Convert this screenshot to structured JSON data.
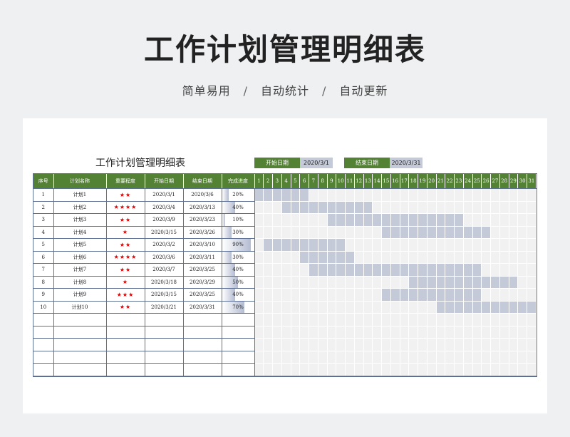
{
  "hero": {
    "title": "工作计划管理明细表",
    "tagline": [
      "简单易用",
      "自动统计",
      "自动更新"
    ],
    "separator": "/"
  },
  "sheet": {
    "title": "工作计划管理明细表",
    "start_label": "开始日期",
    "start_value": "2020/3/1",
    "end_label": "结束日期",
    "end_value": "2020/3/31"
  },
  "columns": [
    "序号",
    "计划名称",
    "重要程度",
    "开始日期",
    "结束日期",
    "完成进度"
  ],
  "days": [
    "1",
    "2",
    "3",
    "4",
    "5",
    "6",
    "7",
    "8",
    "9",
    "10",
    "11",
    "12",
    "13",
    "14",
    "15",
    "16",
    "17",
    "18",
    "19",
    "20",
    "21",
    "22",
    "23",
    "24",
    "25",
    "26",
    "27",
    "28",
    "29",
    "30",
    "31"
  ],
  "rows": [
    {
      "no": "1",
      "name": "计划1",
      "stars": "★★",
      "start": "2020/3/1",
      "end": "2020/3/6",
      "progress": "20%",
      "progress_value": 0.2,
      "range": [
        1,
        6
      ]
    },
    {
      "no": "2",
      "name": "计划2",
      "stars": "★★★★",
      "start": "2020/3/4",
      "end": "2020/3/13",
      "progress": "40%",
      "progress_value": 0.4,
      "range": [
        4,
        13
      ]
    },
    {
      "no": "3",
      "name": "计划3",
      "stars": "★★",
      "start": "2020/3/9",
      "end": "2020/3/23",
      "progress": "10%",
      "progress_value": 0.1,
      "range": [
        9,
        23
      ]
    },
    {
      "no": "4",
      "name": "计划4",
      "stars": "★",
      "start": "2020/3/15",
      "end": "2020/3/26",
      "progress": "30%",
      "progress_value": 0.3,
      "range": [
        15,
        26
      ]
    },
    {
      "no": "5",
      "name": "计划5",
      "stars": "★★",
      "start": "2020/3/2",
      "end": "2020/3/10",
      "progress": "90%",
      "progress_value": 0.9,
      "range": [
        2,
        10
      ]
    },
    {
      "no": "6",
      "name": "计划6",
      "stars": "★★★★",
      "start": "2020/3/6",
      "end": "2020/3/11",
      "progress": "30%",
      "progress_value": 0.3,
      "range": [
        6,
        11
      ]
    },
    {
      "no": "7",
      "name": "计划7",
      "stars": "★★",
      "start": "2020/3/7",
      "end": "2020/3/25",
      "progress": "40%",
      "progress_value": 0.4,
      "range": [
        7,
        25
      ]
    },
    {
      "no": "8",
      "name": "计划8",
      "stars": "★",
      "start": "2020/3/18",
      "end": "2020/3/29",
      "progress": "50%",
      "progress_value": 0.5,
      "range": [
        18,
        29
      ]
    },
    {
      "no": "9",
      "name": "计划9",
      "stars": "★★★",
      "start": "2020/3/15",
      "end": "2020/3/25",
      "progress": "40%",
      "progress_value": 0.4,
      "range": [
        15,
        25
      ]
    },
    {
      "no": "10",
      "name": "计划10",
      "stars": "★★",
      "start": "2020/3/21",
      "end": "2020/3/31",
      "progress": "70%",
      "progress_value": 0.7,
      "range": [
        21,
        31
      ]
    }
  ],
  "empty_rows": 5,
  "colors": {
    "header_green": "#548235",
    "gantt_fill": "#c5cad9",
    "gantt_empty": "#f1f1f1",
    "star_red": "#e00000",
    "border_blue": "#5d7093"
  }
}
